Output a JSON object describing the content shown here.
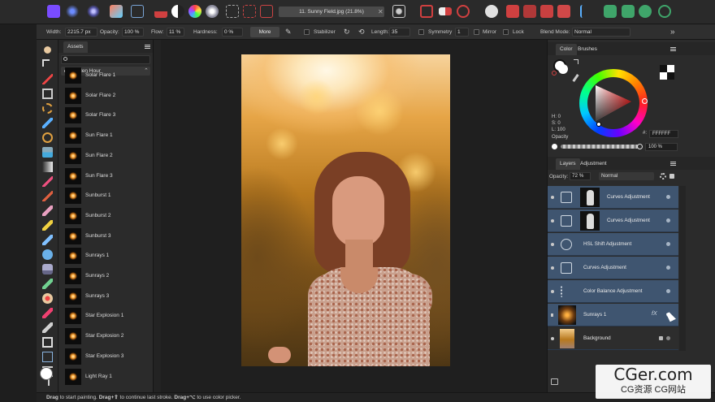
{
  "document": {
    "title": "11. Sunny Field.jpg (21.8%)",
    "close": "✕"
  },
  "context": {
    "width_label": "Width:",
    "width_value": "2215.7 px",
    "opacity_label": "Opacity:",
    "opacity_value": "100 %",
    "flow_label": "Flow:",
    "flow_value": "11 %",
    "hardness_label": "Hardness:",
    "hardness_value": "0 %",
    "more": "More",
    "stabilizer": "Stabilizer",
    "length_label": "Length:",
    "length_value": "35",
    "symmetry": "Symmetry",
    "symmetry_value": "1",
    "mirror": "Mirror",
    "lock": "Lock",
    "blend_label": "Blend Mode:",
    "blend_value": "Normal",
    "expand": "»"
  },
  "assets": {
    "tab": "Assets",
    "search_placeholder": "",
    "category": "Golden Hour",
    "items": [
      "Solar Flare 1",
      "Solar Flare 2",
      "Solar Flare 3",
      "Sun Flare 1",
      "Sun Flare 2",
      "Sun Flare 3",
      "Sunburst 1",
      "Sunburst 2",
      "Sunburst 3",
      "Sunrays 1",
      "Sunrays 2",
      "Sunrays 3",
      "Star Explosion 1",
      "Star Explosion 2",
      "Star Explosion 3",
      "Light Ray 1"
    ]
  },
  "colorPanel": {
    "tabs": [
      "Color",
      "Brushes"
    ],
    "h": "H: 0",
    "s": "S: 0",
    "l": "L: 100",
    "hash": "#:",
    "hex": "FFFFFF",
    "opacity_label": "Opacity",
    "opacity_value": "100 %"
  },
  "layersPanel": {
    "tabs": [
      "Layers",
      "Adjustment"
    ],
    "opacity_label": "Opacity:",
    "opacity_value": "72 %",
    "blend": "Normal",
    "layers": [
      "Curves Adjustment",
      "Curves Adjustment",
      "HSL Shift Adjustment",
      "Curves Adjustment",
      "Color Balance Adjustment",
      "Sunrays 1",
      "Background"
    ],
    "fx": "fX"
  },
  "status": {
    "part1": "Drag",
    "part2": " to start painting. ",
    "part3": "Drag+⇧",
    "part4": " to continue last stroke. ",
    "part5": "Drag+⌥",
    "part6": " to use color picker."
  },
  "watermark": {
    "line1": "CGer.com",
    "line2": "CG资源 CG网站"
  },
  "colors": {
    "selection": "#3f5570",
    "accent": "#7a4cff"
  }
}
